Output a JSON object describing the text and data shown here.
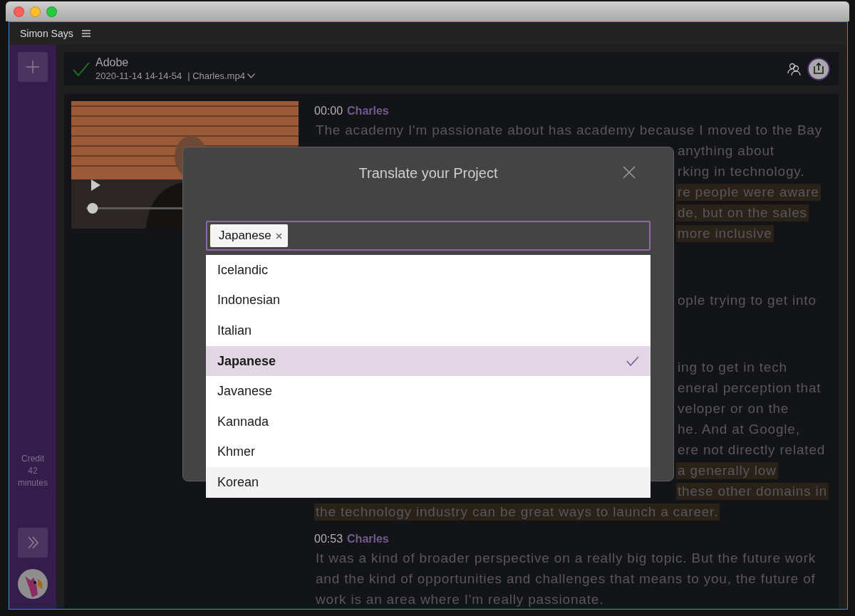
{
  "window": {
    "title": "Simon Says"
  },
  "sidebar": {
    "credit_label": "Credit",
    "credit_value": "42",
    "credit_unit": "minutes"
  },
  "project": {
    "name": "Adobe",
    "date": "2020-11-14 14-14-54",
    "file": "| Charles.mp4",
    "verified": true
  },
  "video": {
    "kind": "picture",
    "level": 0.03
  },
  "transcript": {
    "paragraphs": [
      {
        "time": "00:00",
        "speaker": "Charles",
        "lines": [
          {
            "text": "The academy I'm passionate about has academy because I moved to the Bay",
            "kind": "full",
            "highlighted": false
          },
          {
            "text": "anything about",
            "kind": "partial",
            "highlighted": false
          },
          {
            "text": "rking in technology.",
            "kind": "partial",
            "highlighted": false
          },
          {
            "text": "re people were aware",
            "kind": "partial",
            "highlighted": true
          },
          {
            "text": "de, but on the sales",
            "kind": "partial",
            "highlighted": true
          },
          {
            "text": "more inclusive",
            "kind": "partial",
            "highlighted": true
          }
        ]
      },
      {
        "lines": [
          {
            "text": "ople trying to get into",
            "kind": "partial",
            "highlighted": false
          }
        ]
      },
      {
        "lines": [
          {
            "text": "ing to get in tech",
            "kind": "partial",
            "highlighted": false
          },
          {
            "text": "eneral perception that",
            "kind": "partial",
            "highlighted": false
          },
          {
            "text": "veloper or on the",
            "kind": "partial",
            "highlighted": false
          },
          {
            "text": "he. And at Google,",
            "kind": "partial",
            "highlighted": false
          },
          {
            "text": "ere not directly related",
            "kind": "partial",
            "highlighted": false
          },
          {
            "text": "a generally low",
            "kind": "partial",
            "highlighted": true
          },
          {
            "text": "these other domains in",
            "kind": "partial",
            "highlighted": true
          },
          {
            "text": "the technology industry can be great ways to launch a career.",
            "kind": "full",
            "highlighted": true
          }
        ]
      },
      {
        "time": "00:53",
        "speaker": "Charles",
        "lines": [
          {
            "text": "It was a kind of broader perspective on a really big topic. But the future work",
            "kind": "full",
            "highlighted": false
          },
          {
            "text": "and the kind of opportunities and challenges that means to you, the future of",
            "kind": "full",
            "highlighted": false
          },
          {
            "text": "work is an area where I'm really passionate.",
            "kind": "full",
            "highlighted": false
          }
        ]
      }
    ]
  },
  "dialog": {
    "title": "Translate your Project",
    "chips": [
      {
        "label": "Japanese"
      }
    ],
    "options": [
      {
        "label": "Icelandic",
        "selected": false,
        "hovered": false
      },
      {
        "label": "Indonesian",
        "selected": false,
        "hovered": false
      },
      {
        "label": "Italian",
        "selected": false,
        "hovered": false
      },
      {
        "label": "Japanese",
        "selected": true,
        "hovered": false
      },
      {
        "label": "Javanese",
        "selected": false,
        "hovered": false
      },
      {
        "label": "Kannada",
        "selected": false,
        "hovered": false
      },
      {
        "label": "Khmer",
        "selected": false,
        "hovered": false
      },
      {
        "label": "Korean",
        "selected": false,
        "hovered": true
      }
    ]
  }
}
